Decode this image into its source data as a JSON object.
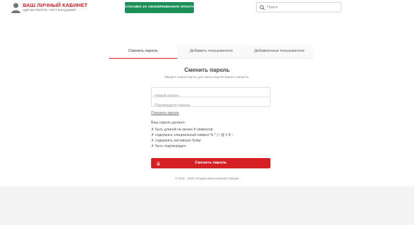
{
  "header": {
    "cabinet_title": "ВАШ ЛИЧНЫЙ КАБИНЕТ",
    "greeting": "ЗДРАВСТВУЙТЕ, ТЕСТ ВЛАДИМИР",
    "pay_button": "СПАСИБО ЗА СВОЕВРЕМЕННУЮ ОПЛАТУ",
    "search_placeholder": "Поиск",
    "search_value": ""
  },
  "tabs": [
    {
      "label": "Сменить пароль",
      "active": true
    },
    {
      "label": "Добавить пользователя",
      "active": false
    },
    {
      "label": "Добавленные пользователи",
      "active": false
    }
  ],
  "form": {
    "title": "Сменить пароль",
    "subtitle": "Введите новый пароль для смены пароля Вашего аккаунта.",
    "new_password_placeholder": "Новый пароль",
    "confirm_password_placeholder": "Подтвердите пароль",
    "show_password": "Показать пароль",
    "requirements_title": "Ваш пароль должен:",
    "requirements": [
      "✗ быть длиной не менее 8 символов",
      "✗ содержать специальный символ % * ) ! @ # $ ~",
      "✗ содержать заглавную букву",
      "✗ быть подтвержден"
    ],
    "submit_label": "Сменить пароль"
  },
  "footer": {
    "copyright": "© 2001 - 2025 Холдинговая компания Танцем"
  },
  "colors": {
    "brand_red": "#d41f25",
    "pay_green": "#1c8f58"
  },
  "icons": {
    "avatar": "user-avatar-icon",
    "search": "search-icon",
    "lock": "lock-icon"
  }
}
